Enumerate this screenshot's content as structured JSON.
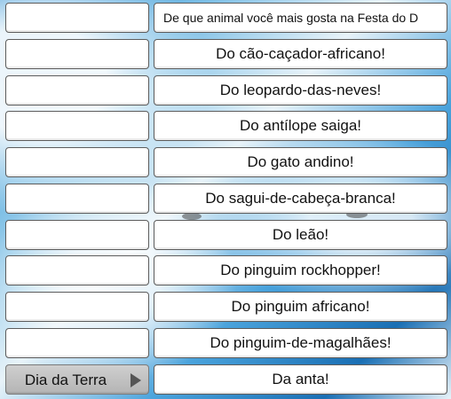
{
  "question": "De que animal você mais gosta na Festa do D",
  "options": [
    "Do cão-caçador-africano!",
    "Do leopardo-das-neves!",
    "Do antílope saiga!",
    "Do gato andino!",
    "Do sagui-de-cabeça-branca!",
    "Do leão!",
    "Do pinguim rockhopper!",
    "Do pinguim africano!",
    "Do pinguim-de-magalhães!",
    "Da anta!"
  ],
  "category_label": "Dia da Terra",
  "category_icon": "arrow-right-icon"
}
